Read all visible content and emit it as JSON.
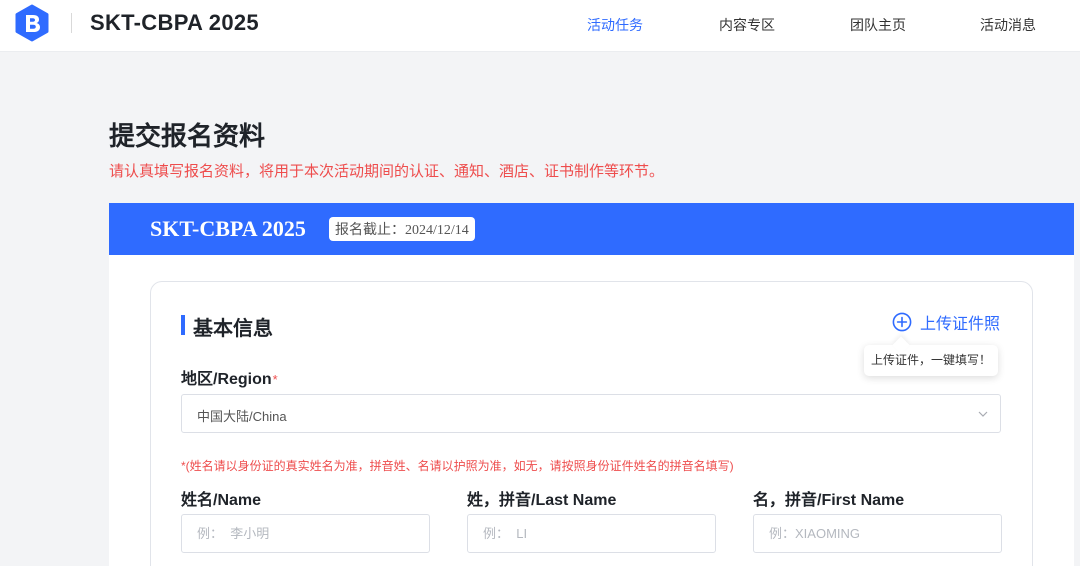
{
  "header": {
    "brand": "SKT-CBPA 2025",
    "nav": [
      {
        "label": "活动任务",
        "active": true
      },
      {
        "label": "内容专区",
        "active": false
      },
      {
        "label": "团队主页",
        "active": false
      },
      {
        "label": "活动消息",
        "active": false
      }
    ]
  },
  "page": {
    "title": "提交报名资料",
    "subtitle": "请认真填写报名资料，将用于本次活动期间的认证、通知、酒店、证书制作等环节。"
  },
  "banner": {
    "title": "SKT-CBPA 2025",
    "deadline_label": "报名截止：",
    "deadline_date": "2024/12/14"
  },
  "form": {
    "section_title": "基本信息",
    "upload_label": "上传证件照",
    "upload_tip": "上传证件，一键填写！",
    "region": {
      "label": "地区/Region",
      "required_mark": "*",
      "value": "中国大陆/China"
    },
    "name_note": "*(姓名请以身份证的真实姓名为准，拼音姓、名请以护照为准，如无，请按照身份证件姓名的拼音名填写)",
    "name": {
      "label": "姓名/Name",
      "placeholder": "例：  李小明"
    },
    "last_name": {
      "label": "姓，拼音/Last Name",
      "placeholder": "例：  LI"
    },
    "first_name": {
      "label": "名，拼音/First Name",
      "placeholder": "例：XIAOMING"
    }
  },
  "colors": {
    "accent": "#2f6bff",
    "error": "#ee4d4d",
    "background": "#f3f4f6"
  },
  "icons": {
    "logo": "brand-logo-icon",
    "upload": "plus-circle-icon",
    "select_arrow": "chevron-down-icon"
  }
}
